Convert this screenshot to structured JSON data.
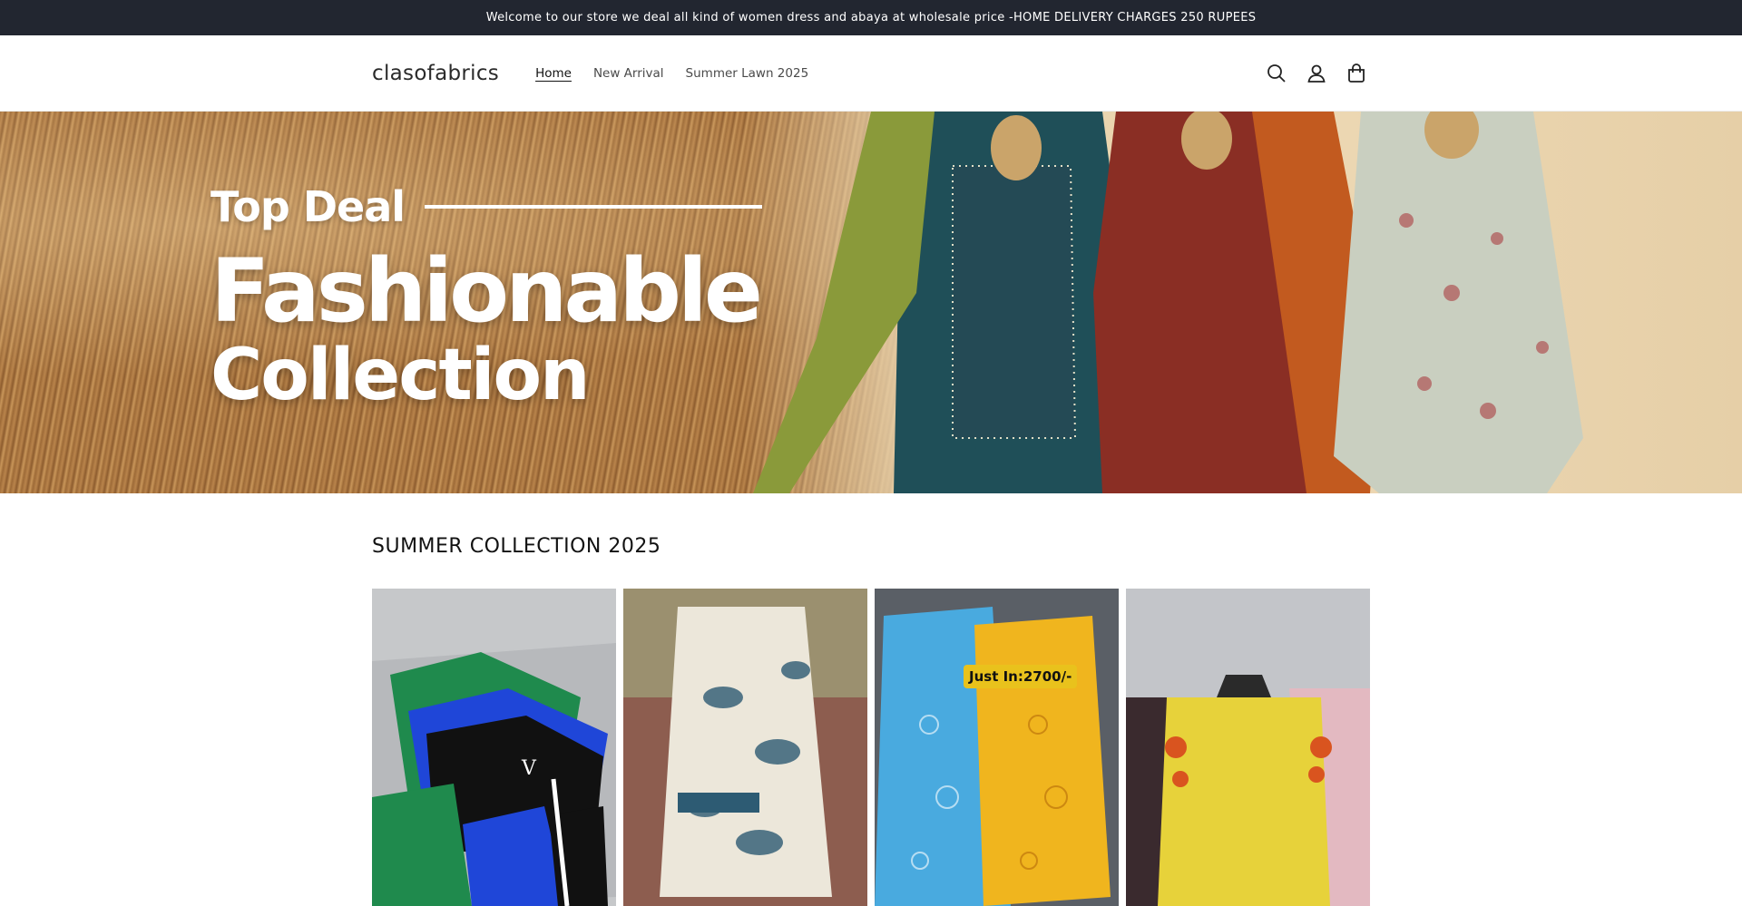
{
  "announcement": {
    "text": "Welcome to our store we deal all kind of women dress and abaya at wholesale price -HOME DELIVERY CHARGES 250 RUPEES"
  },
  "header": {
    "logo": "clasofabrics",
    "nav": [
      {
        "label": "Home",
        "active": true
      },
      {
        "label": "New Arrival",
        "active": false
      },
      {
        "label": "Summer Lawn 2025",
        "active": false
      }
    ],
    "icons": [
      "search-icon",
      "account-icon",
      "cart-icon"
    ]
  },
  "hero": {
    "line1": "Top Deal",
    "line2": "Fashionable",
    "line3": "Collection"
  },
  "collection": {
    "title": "SUMMER COLLECTION 2025",
    "products": [
      {
        "image": "green-blue-black-tracksuit-sets"
      },
      {
        "image": "white-blue-floral-kurta"
      },
      {
        "image": "sky-blue-and-yellow-chikankari-suits",
        "badge": "Just In:2700/-"
      },
      {
        "image": "yellow-embroidered-kurta"
      }
    ]
  },
  "colors": {
    "announcement_bg": "#222630",
    "badge": "#e9c21c"
  }
}
